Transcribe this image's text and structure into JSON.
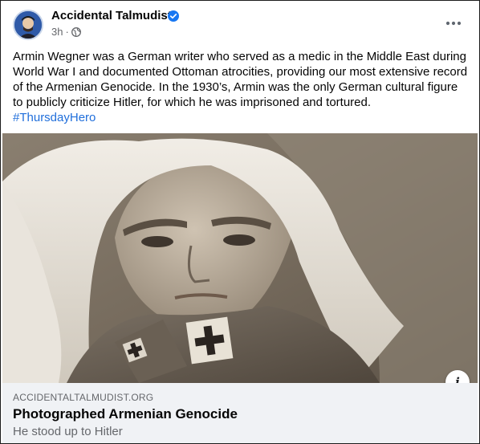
{
  "post": {
    "author": "Accidental Talmudist",
    "time": "3h",
    "separator": "·",
    "audience_icon": "globe-icon",
    "verified_icon": "verified-badge-icon",
    "more_icon": "more-options-icon",
    "text": "Armin Wegner was a German writer who served as a medic in the Middle East during World War I and documented Ottoman atrocities, providing our most extensive record of the Armenian Genocide. In the 1930’s, Armin was the only German cultural figure to publicly criticize Hitler, for which he was imprisoned and tortured.",
    "hashtag": "#ThursdayHero"
  },
  "link": {
    "domain": "ACCIDENTALTALMUDIST.ORG",
    "title": "Photographed Armenian Genocide",
    "subtitle": "He stood up to Hitler",
    "info_icon": "info-icon",
    "info_label": "i"
  },
  "colors": {
    "verified": "#1877f2",
    "hashtag": "#216fdb",
    "link_background": "#f0f2f5"
  }
}
